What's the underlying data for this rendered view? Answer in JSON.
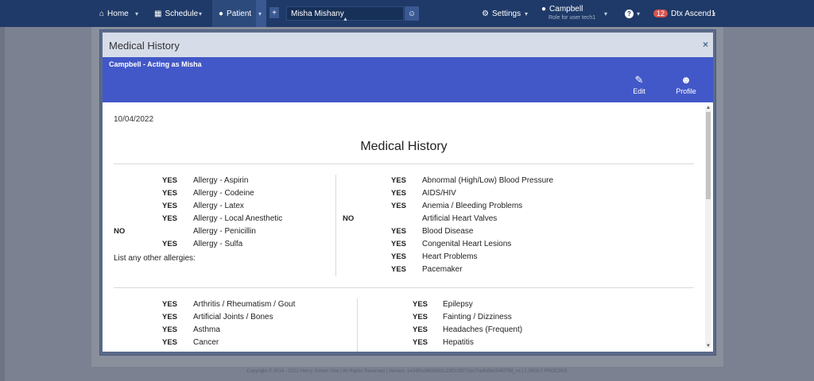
{
  "nav": {
    "home": "Home",
    "schedule": "Schedule",
    "patient": "Patient",
    "plus": "+",
    "patient_search_value": "Misha Mishany",
    "settings": "Settings",
    "location": "Campbell",
    "location_sub": "Role for user tech1",
    "help": "?",
    "notif_count": "12",
    "account": "Dtx Ascend1"
  },
  "footer": "Copyright © 2014 - 2022 Henry Schein One | All Rights Reserved | Version: 1e24f0c065f45b1c28f2cf0071bc7ceffd0b0545f7f8f_ss | 1.0000.0 PROD3NS",
  "modal": {
    "title": "Medical History",
    "close": "×",
    "acting_as": "Campbell - Acting as Misha",
    "edit_label": "Edit",
    "profile_label": "Profile",
    "date": "10/04/2022",
    "doc_title": "Medical History",
    "other_allergies_label": "List any other allergies:",
    "section1_left": [
      {
        "answer": "YES",
        "condition": "Allergy - Aspirin"
      },
      {
        "answer": "YES",
        "condition": "Allergy - Codeine"
      },
      {
        "answer": "YES",
        "condition": "Allergy - Latex"
      },
      {
        "answer": "YES",
        "condition": "Allergy - Local Anesthetic"
      },
      {
        "answer": "NO",
        "condition": "Allergy - Penicillin"
      },
      {
        "answer": "YES",
        "condition": "Allergy - Sulfa"
      }
    ],
    "section1_right": [
      {
        "answer": "YES",
        "condition": "Abnormal (High/Low) Blood Pressure"
      },
      {
        "answer": "YES",
        "condition": "AIDS/HIV"
      },
      {
        "answer": "YES",
        "condition": "Anemia / Bleeding Problems"
      },
      {
        "answer": "NO",
        "condition": "Artificial Heart Valves"
      },
      {
        "answer": "YES",
        "condition": "Blood Disease"
      },
      {
        "answer": "YES",
        "condition": "Congenital Heart Lesions"
      },
      {
        "answer": "YES",
        "condition": "Heart Problems"
      },
      {
        "answer": "YES",
        "condition": "Pacemaker"
      }
    ],
    "section2_left": [
      {
        "answer": "YES",
        "condition": "Arthritis / Rheumatism / Gout"
      },
      {
        "answer": "YES",
        "condition": "Artificial Joints / Bones"
      },
      {
        "answer": "YES",
        "condition": "Asthma"
      },
      {
        "answer": "YES",
        "condition": "Cancer"
      }
    ],
    "section2_right": [
      {
        "answer": "YES",
        "condition": "Epilepsy"
      },
      {
        "answer": "YES",
        "condition": "Fainting / Dizziness"
      },
      {
        "answer": "YES",
        "condition": "Headaches (Frequent)"
      },
      {
        "answer": "YES",
        "condition": "Hepatitis"
      }
    ]
  }
}
